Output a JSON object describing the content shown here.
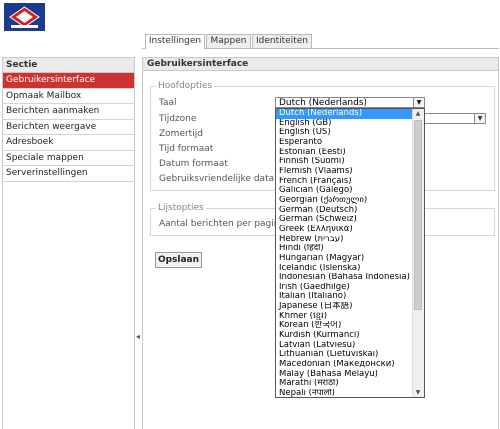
{
  "tabs": [
    {
      "label": "Instellingen"
    },
    {
      "label": "Mappen"
    },
    {
      "label": "Identiteiten"
    }
  ],
  "sidebar": {
    "header": "Sectie",
    "items": [
      {
        "label": "Gebruikersinterface"
      },
      {
        "label": "Opmaak Mailbox"
      },
      {
        "label": "Berichten aanmaken"
      },
      {
        "label": "Berichten weergave"
      },
      {
        "label": "Adresboek"
      },
      {
        "label": "Speciale mappen"
      },
      {
        "label": "Serverinstellingen"
      }
    ]
  },
  "main": {
    "title": "Gebruikersinterface",
    "main_options": {
      "legend": "Hoofdopties",
      "labels": [
        "Taal",
        "Tijdzone",
        "Zomertijd",
        "Tijd formaat",
        "Datum formaat",
        "Gebruiksvriendelijke data"
      ],
      "language_value": "Dutch (Nederlands)"
    },
    "list_options": {
      "legend": "Lijstopties",
      "labels": [
        "Aantal berichten per pagina"
      ]
    },
    "save_label": "Opslaan"
  },
  "language_dropdown": {
    "options": [
      "Dutch (Nederlands)",
      "English (GB)",
      "English (US)",
      "Esperanto",
      "Estonian (Eesti)",
      "Finnish (Suomi)",
      "Flemish (Vlaams)",
      "French (Français)",
      "Galician (Galego)",
      "Georgian (ქართული)",
      "German (Deutsch)",
      "German (Schweiz)",
      "Greek (Ελληνικά)",
      "Hebrew (עברית)",
      "Hindi (हिंदी)",
      "Hungarian (Magyar)",
      "Icelandic (Íslenska)",
      "Indonesian (Bahasa Indonesia)",
      "Irish (Gaedhilge)",
      "Italian (Italiano)",
      "Japanese (日本語)",
      "Khmer (ខ្មែរ)",
      "Korean (한국어)",
      "Kurdish (Kurmancî)",
      "Latvian (Latviešu)",
      "Lithuanian (Lietuviškai)",
      "Macedonian (Македонски)",
      "Malay (Bahasa Melayu)",
      "Marathi (मराठी)",
      "Nepali (नेपाली)"
    ],
    "selected_index": 0
  },
  "colors": {
    "active_nav": "#cc3333",
    "selected_option": "#3399ff",
    "logo_blue": "#1d3b8c"
  }
}
